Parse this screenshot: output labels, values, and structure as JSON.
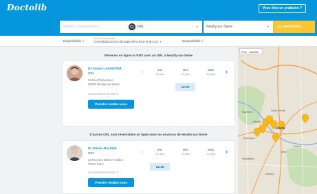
{
  "header": {
    "logo": "Doctolib",
    "pro_button": "Vous êtes un praticien ?"
  },
  "search": {
    "name_placeholder": "Médecin, établissement...",
    "specialty_icon": "ORL",
    "specialty_value": "ORL",
    "location_value": "Neuilly-sur-Seine",
    "button_label": "Rechercher",
    "search_icon": "magnifier-icon"
  },
  "filters": {
    "availability_label": "Disponibilités",
    "availability_caret": "▾",
    "category_small": "Motif de consultation",
    "category_value": "Consultation pour chirurgie de la face et du cou",
    "category_caret": "▾",
    "region_label": "Disponibilités",
    "region_caret": "▾"
  },
  "section1_title": "Réserver en ligne un RDV avec un ORL à Neuilly-sur-Seine",
  "section2_title": "D'autres ORL sont réservables en ligne dans les environs de Neuilly-sur-Seine",
  "doctors": [
    {
      "name": "Dr Xavier LACHEVER",
      "specialty": "ORL",
      "address1": "33 Rue Parmentier",
      "address2": "92200 Neuilly-sur-Seine",
      "convention": "Conventionné secteur 2",
      "button": "Prendre rendez-vous",
      "days": [
        {
          "label": "jeu.",
          "date": "12 janv."
        },
        {
          "label": "ven.",
          "date": "13 janv."
        },
        {
          "label": "sam.",
          "date": "14 janv."
        }
      ],
      "slots": [
        "-",
        "10:00",
        "-",
        "-",
        "-",
        "-",
        "-",
        "-",
        "-",
        "-",
        "-",
        "-"
      ]
    },
    {
      "name": "Dr Olivier Rachtiel",
      "specialty": "ORL",
      "address1": "22 Rue des Belles Feuilles",
      "address2": "75116 Paris",
      "convention": "Conventionné secteur 2",
      "button": "Prendre rendez-vous",
      "days": [
        {
          "label": "jeu.",
          "date": "12 janv."
        },
        {
          "label": "ven.",
          "date": "13 janv."
        },
        {
          "label": "sam.",
          "date": "14 janv."
        }
      ],
      "slots": [
        "14:30",
        "-",
        "-",
        "-",
        "-",
        "-"
      ]
    }
  ],
  "map": {
    "toggle_plan": "Plan",
    "toggle_sat": "Satellite",
    "labels": {
      "saint_denis": "Saint-Denis",
      "neuilly": "Neuilly",
      "paris": "Paris",
      "boulogne": "Boulogne",
      "creteil": "Créteil",
      "vitry": "Vitry",
      "versailles": "Versailles",
      "antony": "Antony",
      "nanterre": "Nanterre"
    },
    "colors": {
      "pin": "#f6b91b",
      "road": "#f4a04a",
      "land": "#e9e4d8",
      "park": "#c8dfb5"
    }
  },
  "colors": {
    "brand": "#0596de",
    "accent": "#fec62e"
  },
  "arrows": {
    "left": "‹",
    "right": "›"
  },
  "dash": "-"
}
